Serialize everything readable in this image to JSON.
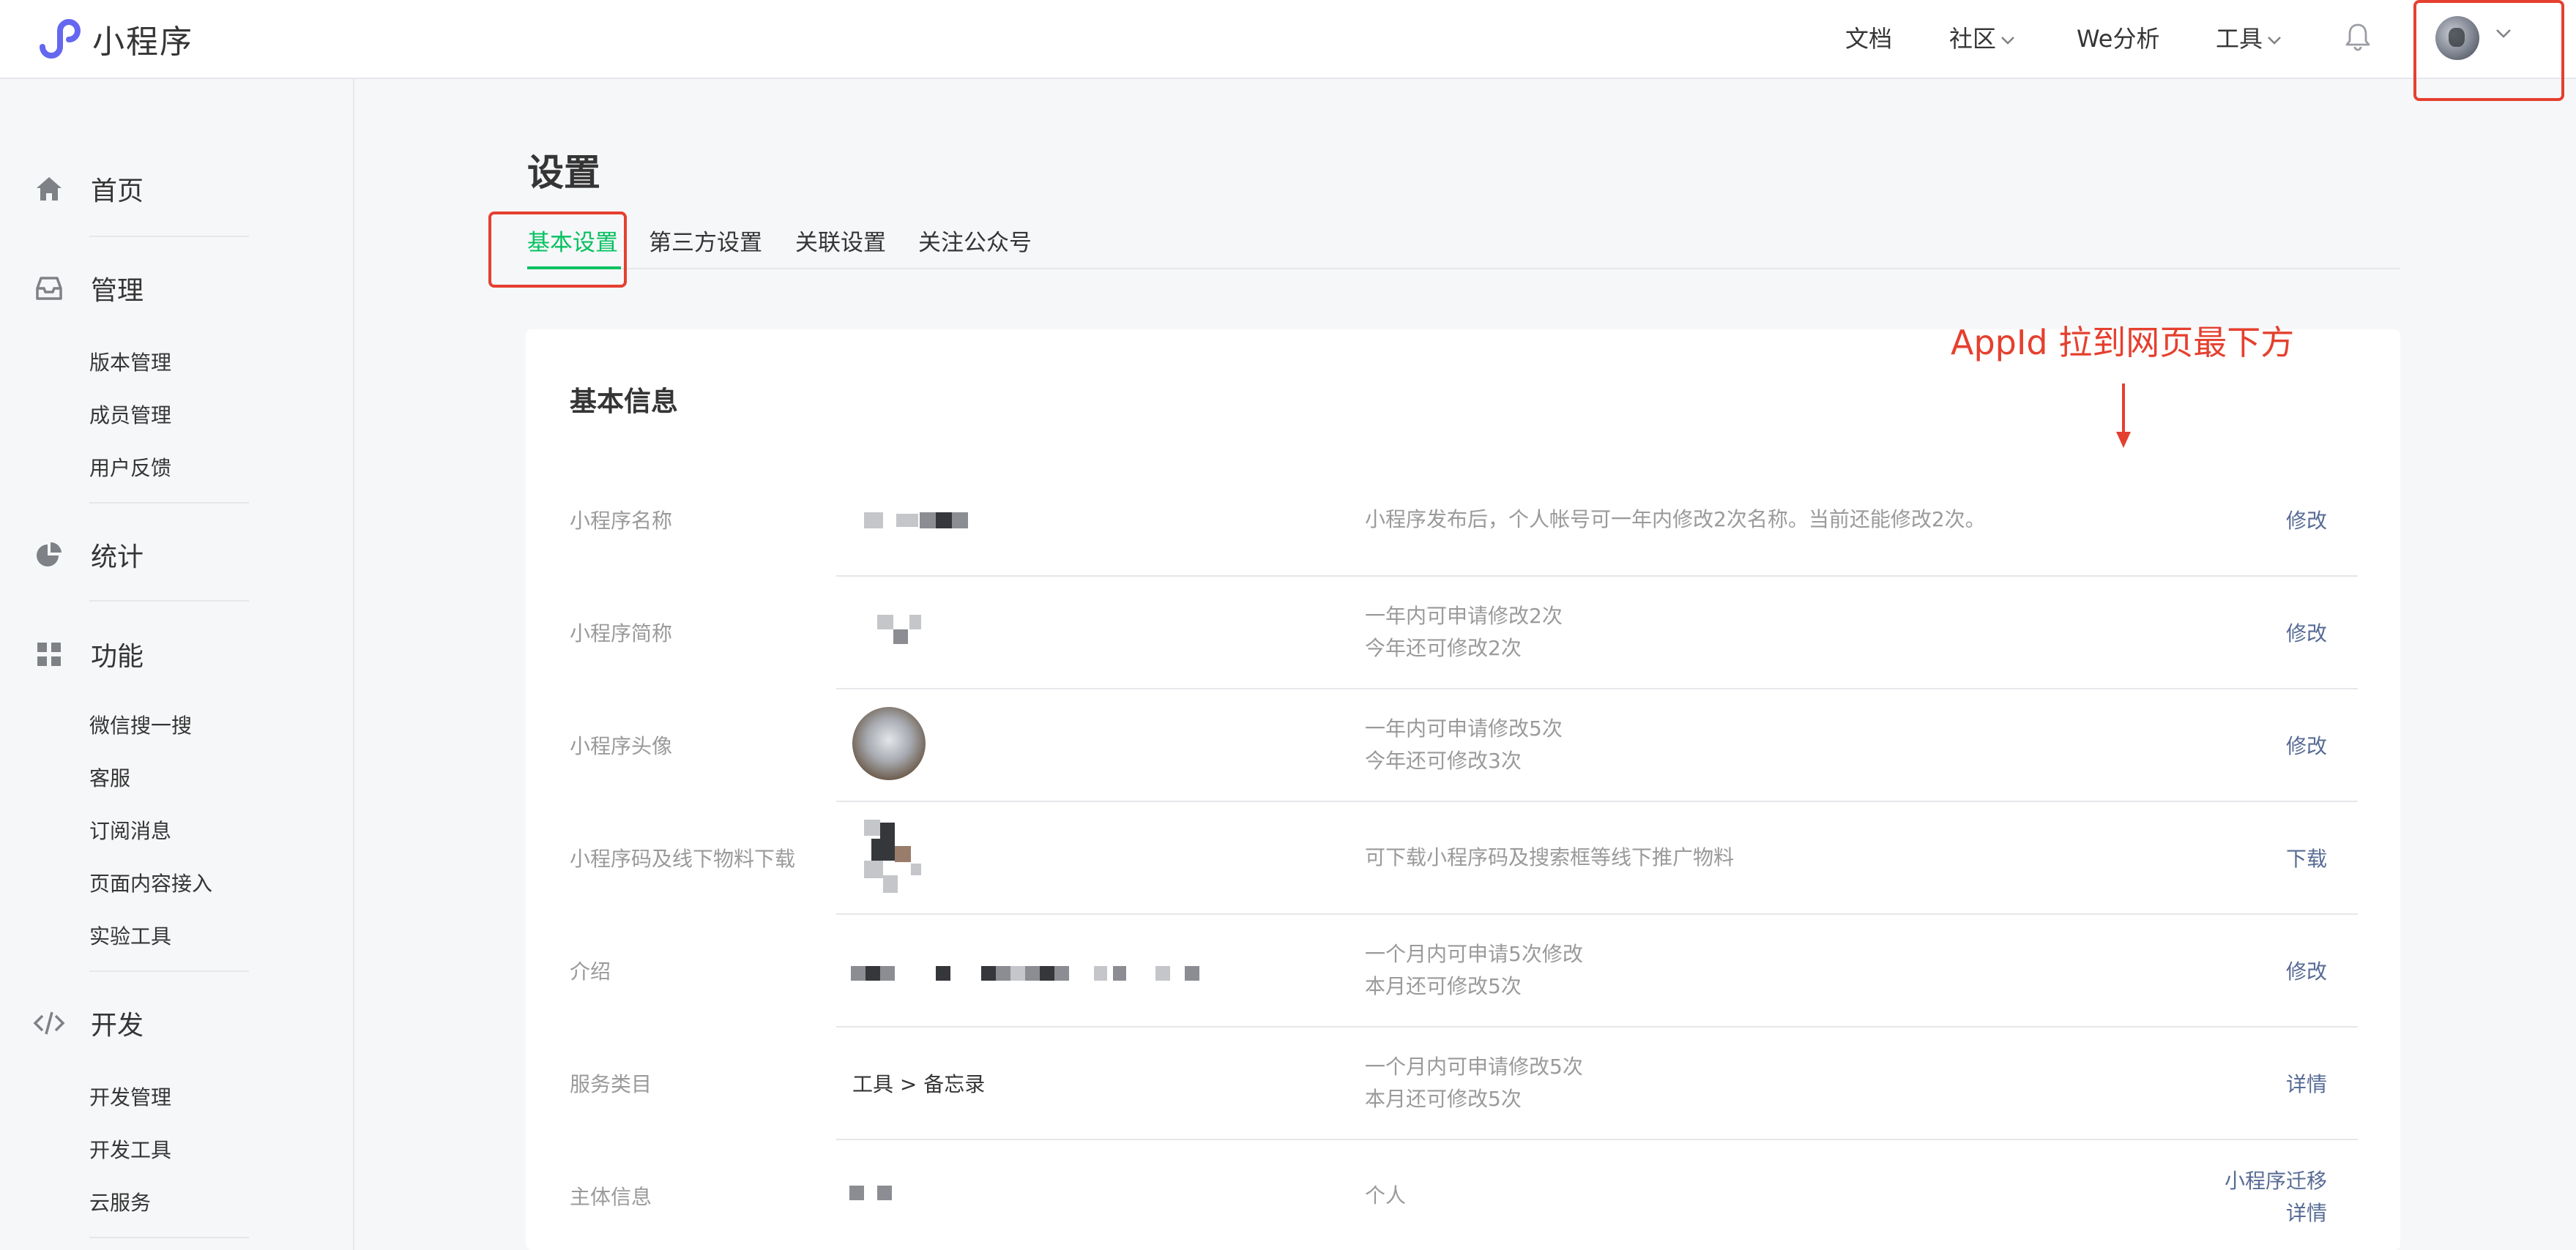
{
  "app": {
    "title": "小程序"
  },
  "topnav": {
    "docs": "文档",
    "community": "社区",
    "analytics": "We分析",
    "tools": "工具"
  },
  "sidebar": {
    "home": "首页",
    "manage": "管理",
    "manage_items": [
      "版本管理",
      "成员管理",
      "用户反馈"
    ],
    "stats": "统计",
    "features": "功能",
    "features_items": [
      "微信搜一搜",
      "客服",
      "订阅消息",
      "页面内容接入",
      "实验工具"
    ],
    "dev": "开发",
    "dev_items": [
      "开发管理",
      "开发工具",
      "云服务"
    ]
  },
  "page": {
    "title": "设置",
    "tabs": [
      "基本设置",
      "第三方设置",
      "关联设置",
      "关注公众号"
    ],
    "active_tab": "基本设置"
  },
  "annotation": {
    "text": "AppId 拉到网页最下方"
  },
  "basic_info": {
    "title": "基本信息",
    "rows": [
      {
        "label": "小程序名称",
        "desc": [
          "小程序发布后，个人帐号可一年内修改2次名称。当前还能修改2次。"
        ],
        "actions": [
          "修改"
        ]
      },
      {
        "label": "小程序简称",
        "desc": [
          "一年内可申请修改2次",
          "今年还可修改2次"
        ],
        "actions": [
          "修改"
        ]
      },
      {
        "label": "小程序头像",
        "desc": [
          "一年内可申请修改5次",
          "今年还可修改3次"
        ],
        "actions": [
          "修改"
        ]
      },
      {
        "label": "小程序码及线下物料下载",
        "desc": [
          "可下载小程序码及搜索框等线下推广物料"
        ],
        "actions": [
          "下载"
        ]
      },
      {
        "label": "介绍",
        "desc": [
          "一个月内可申请5次修改",
          "本月还可修改5次"
        ],
        "actions": [
          "修改"
        ]
      },
      {
        "label": "服务类目",
        "value": "工具 > 备忘录",
        "desc": [
          "一个月内可申请修改5次",
          "本月还可修改5次"
        ],
        "actions": [
          "详情"
        ]
      },
      {
        "label": "主体信息",
        "desc": [
          "个人"
        ],
        "actions": [
          "小程序迁移",
          "详情"
        ]
      }
    ]
  },
  "colors": {
    "accent": "#07c160",
    "link": "#576b95",
    "annotation": "#e5402f"
  }
}
